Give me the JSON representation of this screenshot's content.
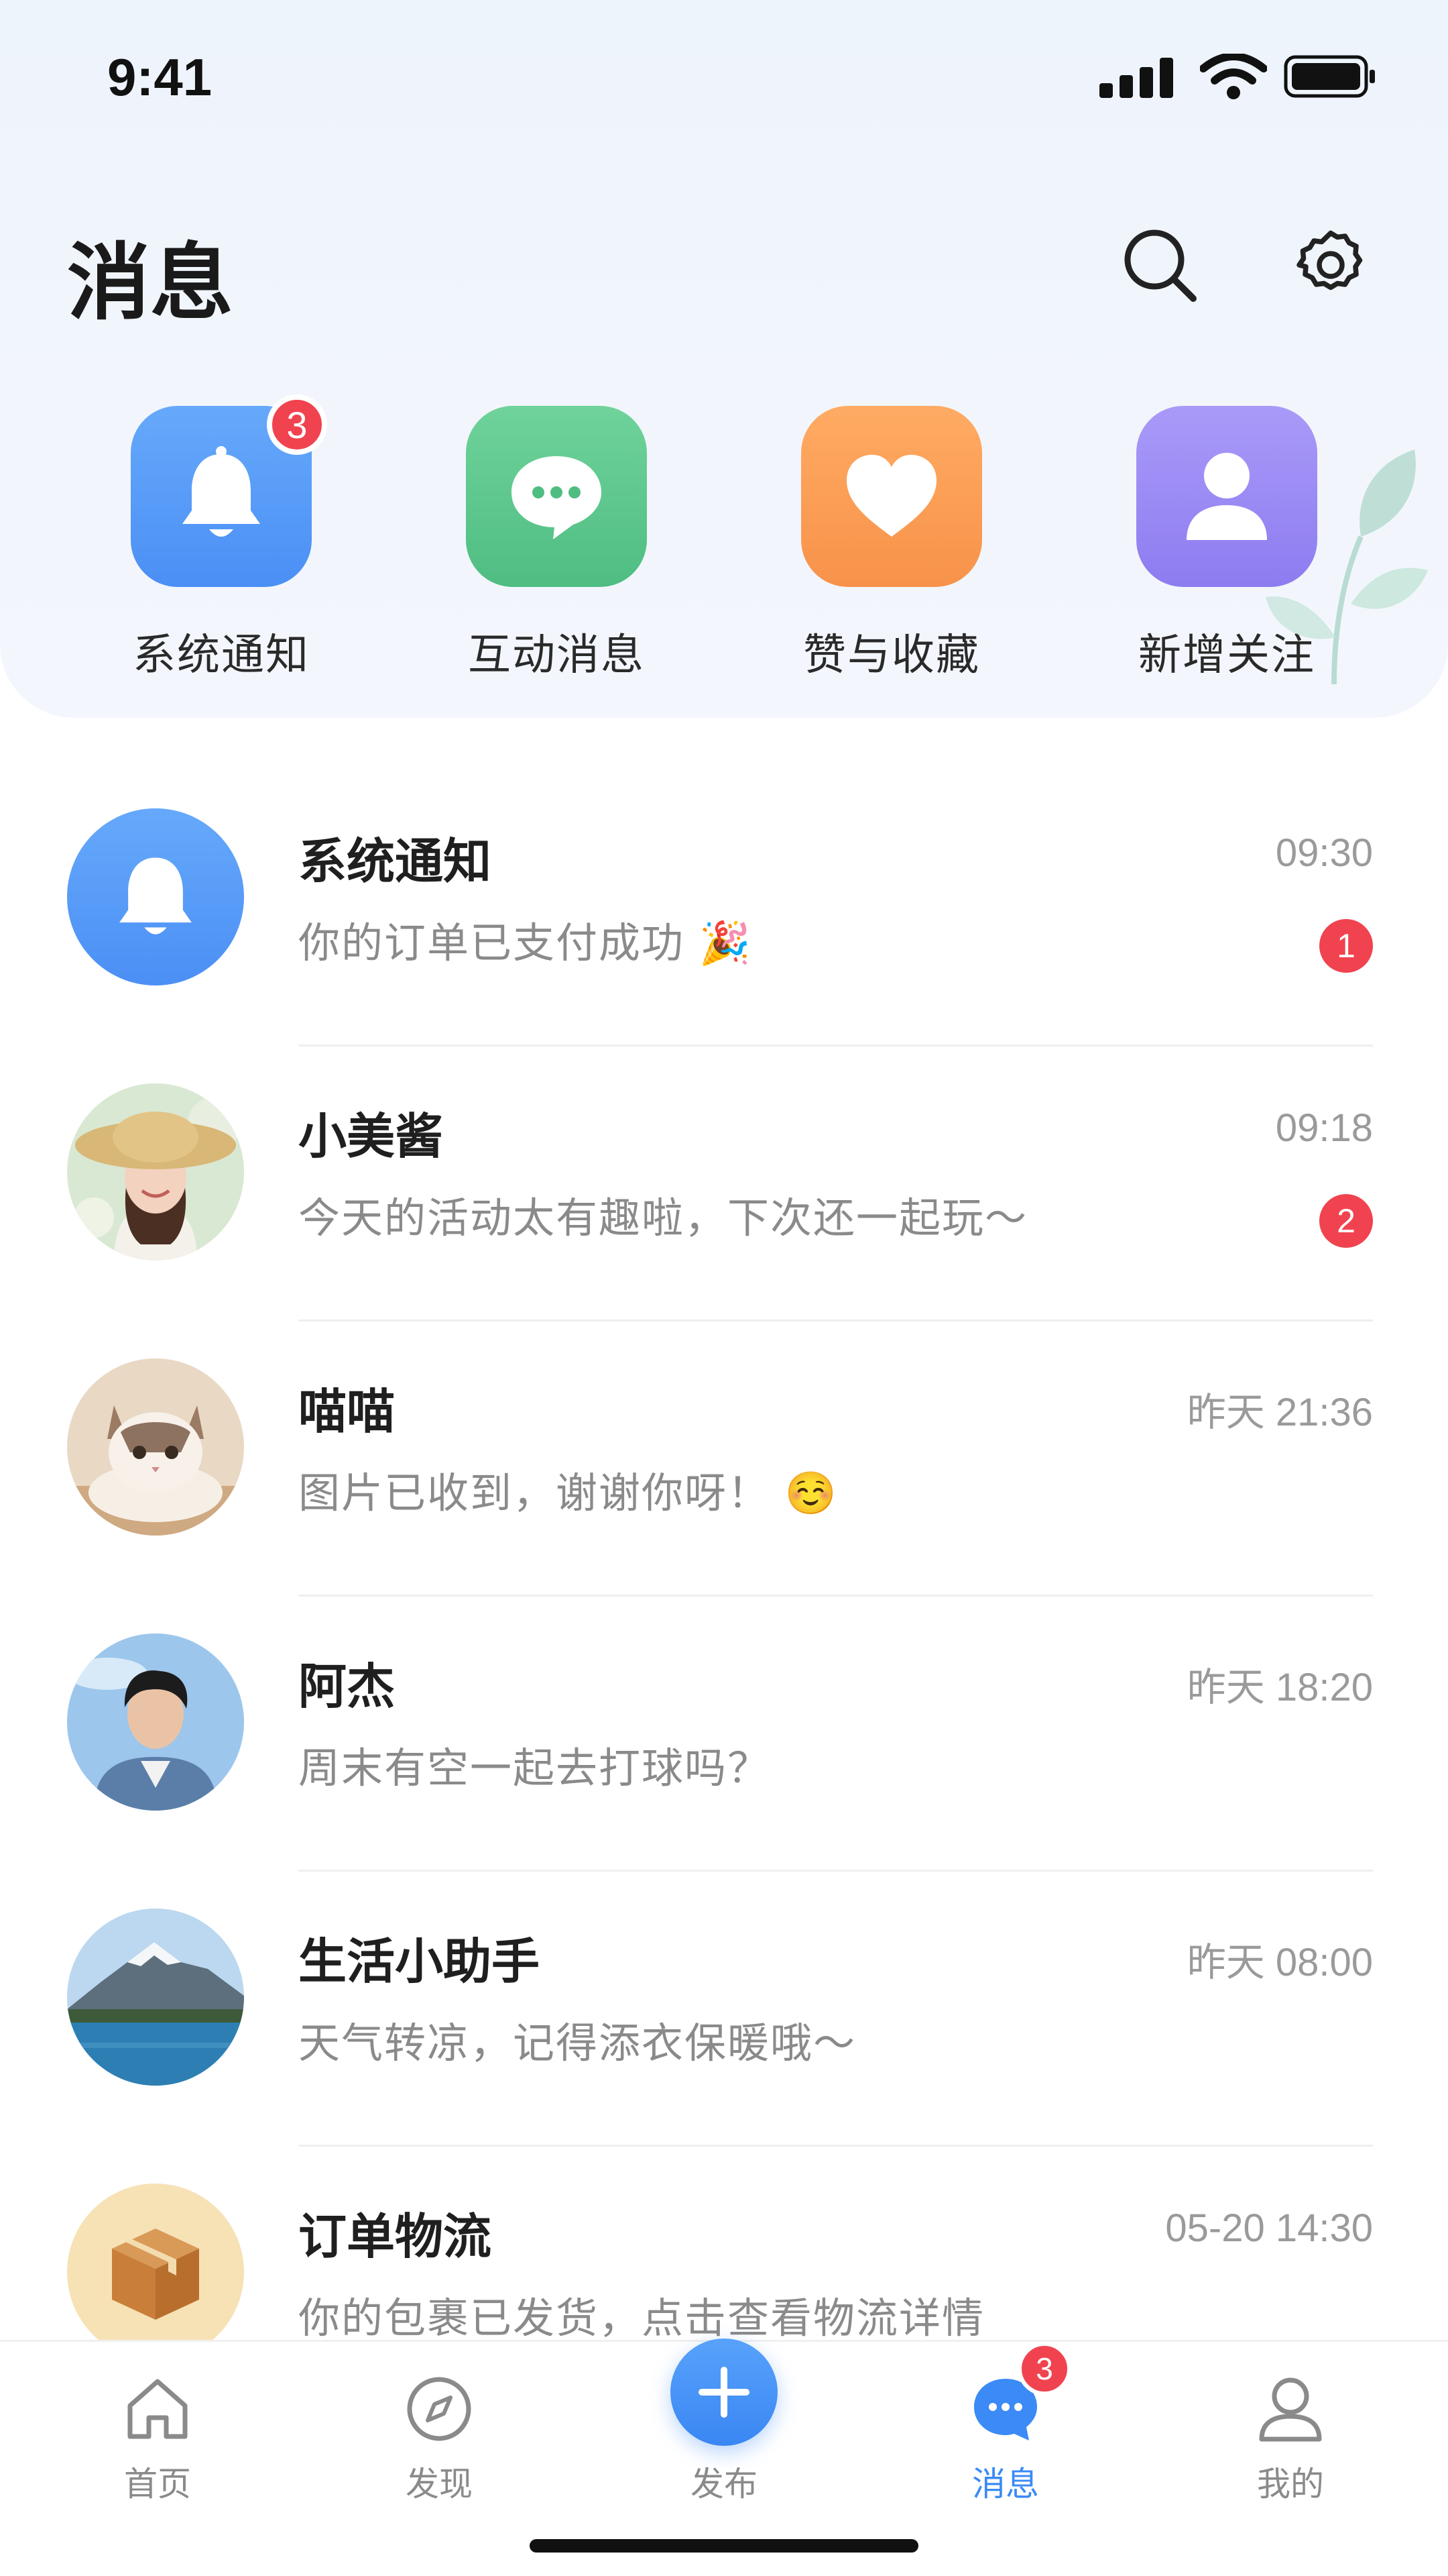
{
  "status_bar": {
    "time": "9:41"
  },
  "header": {
    "title": "消息"
  },
  "quick_entries": [
    {
      "label": "系统通知",
      "badge": "3",
      "icon": "bell-icon",
      "color": "#4b8ff5"
    },
    {
      "label": "互动消息",
      "icon": "chat-bubble-icon",
      "color": "#4fbd82"
    },
    {
      "label": "赞与收藏",
      "icon": "heart-icon",
      "color": "#f8924a"
    },
    {
      "label": "新增关注",
      "icon": "person-icon",
      "color": "#8d7cf0"
    }
  ],
  "conversations": [
    {
      "name": "系统通知",
      "preview": "你的订单已支付成功 🎉",
      "time": "09:30",
      "unread": "1",
      "avatar": "bell-avatar"
    },
    {
      "name": "小美酱",
      "preview": "今天的活动太有趣啦，下次还一起玩～",
      "time": "09:18",
      "unread": "2",
      "avatar": "girl-straw-hat-avatar"
    },
    {
      "name": "喵喵",
      "preview": "图片已收到，谢谢你呀！ ☺️",
      "time": "昨天 21:36",
      "avatar": "cat-avatar"
    },
    {
      "name": "阿杰",
      "preview": "周末有空一起去打球吗？",
      "time": "昨天 18:20",
      "avatar": "young-man-avatar"
    },
    {
      "name": "生活小助手",
      "preview": "天气转凉，记得添衣保暖哦～",
      "time": "昨天 08:00",
      "avatar": "mountain-lake-avatar"
    },
    {
      "name": "订单物流",
      "preview": "你的包裹已发货，点击查看物流详情",
      "time": "05-20 14:30",
      "avatar": "package-box-avatar"
    }
  ],
  "tabbar": {
    "tabs": [
      {
        "label": "首页",
        "icon": "home-icon"
      },
      {
        "label": "发现",
        "icon": "compass-icon"
      },
      {
        "label": "发布",
        "icon": "plus-icon"
      },
      {
        "label": "消息",
        "icon": "message-icon",
        "badge": "3",
        "active": true
      },
      {
        "label": "我的",
        "icon": "profile-icon"
      }
    ]
  },
  "colors": {
    "accent": "#3b8af5",
    "badge": "#f0434f"
  }
}
